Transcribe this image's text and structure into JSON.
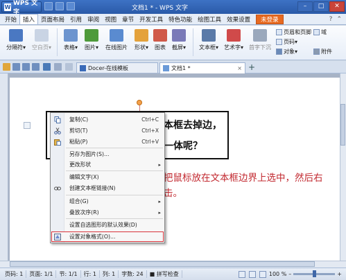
{
  "titlebar": {
    "app_name": "WPS 文字",
    "doc_title": "文档1 * - WPS 文字",
    "controls": [
      "–",
      "□",
      "✕"
    ]
  },
  "menu_tabs": [
    "开始",
    "插入",
    "页面布局",
    "引用",
    "审阅",
    "视图",
    "章节",
    "开发工具",
    "特色功能",
    "绘图工具",
    "效果设置"
  ],
  "active_menu_tab": "插入",
  "login_label": "未登录",
  "ribbon": {
    "items": [
      {
        "name": "page-break",
        "label": "分隔符▾",
        "color": "#4a78c2"
      },
      {
        "name": "blank-page",
        "label": "空白页▾",
        "color": "#c9d4e4"
      },
      {
        "name": "table",
        "label": "表格▾",
        "color": "#6c94cf"
      },
      {
        "name": "picture",
        "label": "图片▾",
        "color": "#4e9a3a"
      },
      {
        "name": "online-picture",
        "label": "在线图片",
        "color": "#5a8bd0"
      },
      {
        "name": "shape",
        "label": "形状▾",
        "color": "#e4a23b"
      },
      {
        "name": "chart",
        "label": "图表",
        "color": "#d05a4a"
      },
      {
        "name": "screenshot",
        "label": "截屏▾",
        "color": "#7a7ab8"
      },
      {
        "name": "textbox",
        "label": "文本框▾",
        "color": "#5a7aa8"
      },
      {
        "name": "art-text",
        "label": "艺术字▾",
        "color": "#d04a4a"
      },
      {
        "name": "drop-cap",
        "label": "首字下沉",
        "color": "#9aa8bc"
      },
      {
        "name": "object",
        "label": "对象▾",
        "color": "#6a8ab8"
      },
      {
        "name": "attachment",
        "label": "附件",
        "color": "#8a9ab0"
      }
    ],
    "small_buttons": [
      "页眉和页脚",
      "页码▾",
      "域"
    ]
  },
  "tabs": {
    "docer": "Docer-在线模板",
    "doc1": "文档1 *",
    "close": "×",
    "add": "+"
  },
  "document": {
    "textbox_line1": "本框去掉边，",
    "textbox_line2": "一体呢？",
    "annotation": "把鼠标放在文本框边界上选中，然后右击。"
  },
  "context_menu": {
    "items": [
      {
        "name": "copy",
        "icon": "copy-icon",
        "label": "复制(C)",
        "shortcut": "Ctrl+C"
      },
      {
        "name": "cut",
        "icon": "scissors-icon",
        "label": "剪切(T)",
        "shortcut": "Ctrl+X"
      },
      {
        "name": "paste",
        "icon": "paste-icon",
        "label": "粘贴(P)",
        "shortcut": "Ctrl+V"
      },
      {
        "name": "save-as-picture",
        "label": "另存为图片(S)..."
      },
      {
        "name": "change-shape",
        "label": "更改形状",
        "submenu": true
      },
      {
        "name": "edit-text",
        "label": "编辑文字(X)"
      },
      {
        "name": "create-link",
        "icon": "link-icon",
        "label": "创建文本框链接(N)"
      },
      {
        "name": "group",
        "label": "组合(G)",
        "submenu": true
      },
      {
        "name": "order",
        "label": "叠放次序(R)",
        "submenu": true
      },
      {
        "name": "set-default",
        "label": "设置自选图形的默认效果(D)"
      },
      {
        "name": "format-object",
        "icon": "format-icon",
        "label": "设置对象格式(O)..."
      }
    ]
  },
  "status": {
    "items": [
      "页码: 1",
      "页面: 1/1",
      "节: 1/1",
      "行: 1",
      "列: 1",
      "字数: 24",
      "拼写检查"
    ],
    "zoom": "100 %"
  }
}
